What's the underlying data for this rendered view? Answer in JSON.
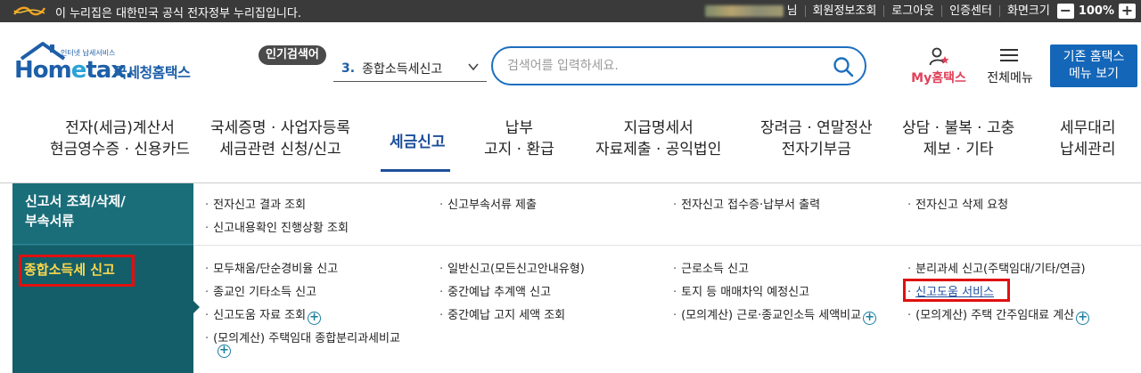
{
  "govbar": {
    "notice": "이 누리집은 대한민국 공식 전자정부 누리집입니다.",
    "user_suffix": "님",
    "links": [
      "회원정보조회",
      "로그아웃",
      "인증센터",
      "화면크기"
    ],
    "zoom_minus": "−",
    "zoom_value": "100%",
    "zoom_plus": "+"
  },
  "brand": {
    "subtitle": "인터넷 납세서비스",
    "home_pre": "Hom",
    "home_e": "e",
    "home_post": "tax.",
    "korean": "국세청홈택스"
  },
  "popular": {
    "tag": "인기검색어",
    "rank": "3.",
    "keyword": "종합소득세신고"
  },
  "search": {
    "placeholder": "검색어를 입력하세요."
  },
  "header": {
    "my_label": "My홈택스",
    "all_menu_label": "전체메뉴",
    "old_home_line1": "기존 홈택스",
    "old_home_line2": "메뉴 보기"
  },
  "nav": {
    "items": [
      {
        "l1": "전자(세금)계산서",
        "l2": "현금영수증 · 신용카드"
      },
      {
        "l1": "국세증명 · 사업자등록",
        "l2": "세금관련 신청/신고"
      },
      {
        "l1": "세금신고",
        "l2": ""
      },
      {
        "l1": "납부",
        "l2": "고지 · 환급"
      },
      {
        "l1": "지급명세서",
        "l2": "자료제출 · 공익법인"
      },
      {
        "l1": "장려금 · 연말정산",
        "l2": "전자기부금"
      },
      {
        "l1": "상담 · 불복 · 고충",
        "l2": "제보 · 기타"
      },
      {
        "l1": "세무대리",
        "l2": "납세관리"
      }
    ]
  },
  "submenu": {
    "section1": {
      "title_l1": "신고서 조회/삭제/",
      "title_l2": "부속서류",
      "items": [
        "전자신고 결과 조회",
        "신고부속서류 제출",
        "전자신고 접수증·납부서 출력",
        "전자신고 삭제 요청",
        "신고내용확인 진행상황 조회"
      ]
    },
    "section2": {
      "title": "종합소득세 신고",
      "items": [
        "모두채움/단순경비율 신고",
        "일반신고(모든신고안내유형)",
        "근로소득 신고",
        "분리과세 신고(주택임대/기타/연금)",
        "종교인 기타소득 신고",
        "중간예납 추계액 신고",
        "토지 등 매매차익 예정신고",
        "신고도움 서비스",
        "신고도움 자료 조회",
        "중간예납 고지 세액 조회",
        "(모의계산) 근로·종교인소득 세액비교",
        "(모의계산) 주택 간주임대료 계산",
        "(모의계산) 주택임대 종합분리과세비교"
      ]
    },
    "dot": "·",
    "plus": "+"
  },
  "colors": {
    "brand_blue": "#1d5fa8",
    "side_teal": "#1a6e7a",
    "highlight_red": "#e01010",
    "label_yellow": "#ffd84a"
  }
}
